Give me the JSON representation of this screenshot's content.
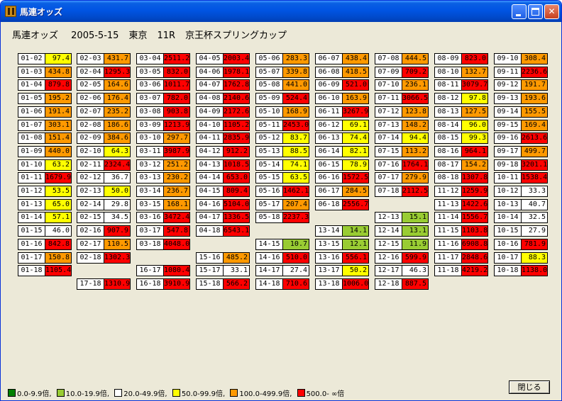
{
  "window": {
    "title": "馬連オッズ"
  },
  "titlebar_buttons": {
    "minimize": "minimize-icon",
    "maximize": "maximize-icon",
    "close": "✕"
  },
  "header": {
    "title": "馬連オッズ",
    "date": "2005-5-15",
    "venue": "東京",
    "race": "11R",
    "race_name": "京王杯スプリングカップ"
  },
  "colors": {
    "green": "#008000",
    "yellowgreen": "#99cc33",
    "white": "#ffffff",
    "yellow": "#ffff00",
    "orange": "#ff9900",
    "red": "#ff0000"
  },
  "columns": [
    [
      {
        "pair": "01-02",
        "odds": "97.4",
        "color": "yellow"
      },
      {
        "pair": "01-03",
        "odds": "434.8",
        "color": "orange"
      },
      {
        "pair": "01-04",
        "odds": "879.8",
        "color": "red"
      },
      {
        "pair": "01-05",
        "odds": "195.2",
        "color": "orange"
      },
      {
        "pair": "01-06",
        "odds": "191.4",
        "color": "orange"
      },
      {
        "pair": "01-07",
        "odds": "303.1",
        "color": "orange"
      },
      {
        "pair": "01-08",
        "odds": "151.4",
        "color": "orange"
      },
      {
        "pair": "01-09",
        "odds": "440.0",
        "color": "orange"
      },
      {
        "pair": "01-10",
        "odds": "63.2",
        "color": "yellow"
      },
      {
        "pair": "01-11",
        "odds": "1679.9",
        "color": "red"
      },
      {
        "pair": "01-12",
        "odds": "53.5",
        "color": "yellow"
      },
      {
        "pair": "01-13",
        "odds": "65.0",
        "color": "yellow"
      },
      {
        "pair": "01-14",
        "odds": "57.1",
        "color": "yellow"
      },
      {
        "pair": "01-15",
        "odds": "46.0",
        "color": "white"
      },
      {
        "pair": "01-16",
        "odds": "842.8",
        "color": "red"
      },
      {
        "pair": "01-17",
        "odds": "150.8",
        "color": "orange"
      },
      {
        "pair": "01-18",
        "odds": "1105.4",
        "color": "red"
      }
    ],
    [
      {
        "pair": "02-03",
        "odds": "431.7",
        "color": "orange"
      },
      {
        "pair": "02-04",
        "odds": "1295.3",
        "color": "red"
      },
      {
        "pair": "02-05",
        "odds": "164.6",
        "color": "orange"
      },
      {
        "pair": "02-06",
        "odds": "176.4",
        "color": "orange"
      },
      {
        "pair": "02-07",
        "odds": "235.2",
        "color": "orange"
      },
      {
        "pair": "02-08",
        "odds": "186.6",
        "color": "orange"
      },
      {
        "pair": "02-09",
        "odds": "384.6",
        "color": "orange"
      },
      {
        "pair": "02-10",
        "odds": "64.3",
        "color": "yellow"
      },
      {
        "pair": "02-11",
        "odds": "2324.4",
        "color": "red"
      },
      {
        "pair": "02-12",
        "odds": "36.7",
        "color": "white"
      },
      {
        "pair": "02-13",
        "odds": "50.0",
        "color": "yellow"
      },
      {
        "pair": "02-14",
        "odds": "29.8",
        "color": "white"
      },
      {
        "pair": "02-15",
        "odds": "34.5",
        "color": "white"
      },
      {
        "pair": "02-16",
        "odds": "907.9",
        "color": "red"
      },
      {
        "pair": "02-17",
        "odds": "110.5",
        "color": "orange"
      },
      {
        "pair": "02-18",
        "odds": "1302.3",
        "color": "red"
      },
      {
        "pair": "17-18",
        "odds": "1310.9",
        "color": "red"
      }
    ],
    [
      {
        "pair": "03-04",
        "odds": "2511.2",
        "color": "red"
      },
      {
        "pair": "03-05",
        "odds": "832.0",
        "color": "red"
      },
      {
        "pair": "03-06",
        "odds": "1011.7",
        "color": "red"
      },
      {
        "pair": "03-07",
        "odds": "782.0",
        "color": "red"
      },
      {
        "pair": "03-08",
        "odds": "903.8",
        "color": "red"
      },
      {
        "pair": "03-09",
        "odds": "1213.9",
        "color": "red"
      },
      {
        "pair": "03-10",
        "odds": "297.7",
        "color": "orange"
      },
      {
        "pair": "03-11",
        "odds": "3987.9",
        "color": "red"
      },
      {
        "pair": "03-12",
        "odds": "251.2",
        "color": "orange"
      },
      {
        "pair": "03-13",
        "odds": "230.2",
        "color": "orange"
      },
      {
        "pair": "03-14",
        "odds": "236.7",
        "color": "orange"
      },
      {
        "pair": "03-15",
        "odds": "168.1",
        "color": "orange"
      },
      {
        "pair": "03-16",
        "odds": "3472.4",
        "color": "red"
      },
      {
        "pair": "03-17",
        "odds": "547.8",
        "color": "red"
      },
      {
        "pair": "03-18",
        "odds": "4048.0",
        "color": "red"
      },
      {
        "pair": "16-17",
        "odds": "1080.4",
        "color": "red"
      },
      {
        "pair": "16-18",
        "odds": "3910.9",
        "color": "red"
      }
    ],
    [
      {
        "pair": "04-05",
        "odds": "2003.4",
        "color": "red"
      },
      {
        "pair": "04-06",
        "odds": "1978.1",
        "color": "red"
      },
      {
        "pair": "04-07",
        "odds": "1762.8",
        "color": "red"
      },
      {
        "pair": "04-08",
        "odds": "2140.6",
        "color": "red"
      },
      {
        "pair": "04-09",
        "odds": "2172.6",
        "color": "red"
      },
      {
        "pair": "04-10",
        "odds": "1105.2",
        "color": "red"
      },
      {
        "pair": "04-11",
        "odds": "2835.9",
        "color": "red"
      },
      {
        "pair": "04-12",
        "odds": "912.2",
        "color": "red"
      },
      {
        "pair": "04-13",
        "odds": "1018.5",
        "color": "red"
      },
      {
        "pair": "04-14",
        "odds": "653.0",
        "color": "red"
      },
      {
        "pair": "04-15",
        "odds": "809.4",
        "color": "red"
      },
      {
        "pair": "04-16",
        "odds": "5104.0",
        "color": "red"
      },
      {
        "pair": "04-17",
        "odds": "1336.5",
        "color": "red"
      },
      {
        "pair": "04-18",
        "odds": "6543.1",
        "color": "red"
      },
      {
        "pair": "15-16",
        "odds": "485.2",
        "color": "orange"
      },
      {
        "pair": "15-17",
        "odds": "33.1",
        "color": "white"
      },
      {
        "pair": "15-18",
        "odds": "566.2",
        "color": "red"
      }
    ],
    [
      {
        "pair": "05-06",
        "odds": "283.3",
        "color": "orange"
      },
      {
        "pair": "05-07",
        "odds": "339.8",
        "color": "orange"
      },
      {
        "pair": "05-08",
        "odds": "441.0",
        "color": "orange"
      },
      {
        "pair": "05-09",
        "odds": "524.4",
        "color": "red"
      },
      {
        "pair": "05-10",
        "odds": "168.9",
        "color": "orange"
      },
      {
        "pair": "05-11",
        "odds": "2453.0",
        "color": "red"
      },
      {
        "pair": "05-12",
        "odds": "83.7",
        "color": "yellow"
      },
      {
        "pair": "05-13",
        "odds": "88.5",
        "color": "yellow"
      },
      {
        "pair": "05-14",
        "odds": "74.1",
        "color": "yellow"
      },
      {
        "pair": "05-15",
        "odds": "63.5",
        "color": "yellow"
      },
      {
        "pair": "05-16",
        "odds": "1462.1",
        "color": "red"
      },
      {
        "pair": "05-17",
        "odds": "207.4",
        "color": "orange"
      },
      {
        "pair": "05-18",
        "odds": "2237.3",
        "color": "red"
      },
      {
        "pair": "14-15",
        "odds": "10.7",
        "color": "yellowgreen"
      },
      {
        "pair": "14-16",
        "odds": "510.0",
        "color": "red"
      },
      {
        "pair": "14-17",
        "odds": "27.4",
        "color": "white"
      },
      {
        "pair": "14-18",
        "odds": "710.6",
        "color": "red"
      }
    ],
    [
      {
        "pair": "06-07",
        "odds": "438.4",
        "color": "orange"
      },
      {
        "pair": "06-08",
        "odds": "418.5",
        "color": "orange"
      },
      {
        "pair": "06-09",
        "odds": "521.0",
        "color": "red"
      },
      {
        "pair": "06-10",
        "odds": "163.9",
        "color": "orange"
      },
      {
        "pair": "06-11",
        "odds": "3267.9",
        "color": "red"
      },
      {
        "pair": "06-12",
        "odds": "69.1",
        "color": "yellow"
      },
      {
        "pair": "06-13",
        "odds": "74.4",
        "color": "yellow"
      },
      {
        "pair": "06-14",
        "odds": "82.1",
        "color": "yellow"
      },
      {
        "pair": "06-15",
        "odds": "78.9",
        "color": "yellow"
      },
      {
        "pair": "06-16",
        "odds": "1572.5",
        "color": "red"
      },
      {
        "pair": "06-17",
        "odds": "284.5",
        "color": "orange"
      },
      {
        "pair": "06-18",
        "odds": "2556.7",
        "color": "red"
      },
      {
        "pair": "13-14",
        "odds": "14.1",
        "color": "yellowgreen"
      },
      {
        "pair": "13-15",
        "odds": "12.1",
        "color": "yellowgreen"
      },
      {
        "pair": "13-16",
        "odds": "556.1",
        "color": "red"
      },
      {
        "pair": "13-17",
        "odds": "50.2",
        "color": "yellow"
      },
      {
        "pair": "13-18",
        "odds": "1006.0",
        "color": "red"
      }
    ],
    [
      {
        "pair": "07-08",
        "odds": "444.5",
        "color": "orange"
      },
      {
        "pair": "07-09",
        "odds": "709.2",
        "color": "red"
      },
      {
        "pair": "07-10",
        "odds": "236.1",
        "color": "orange"
      },
      {
        "pair": "07-11",
        "odds": "3066.5",
        "color": "red"
      },
      {
        "pair": "07-12",
        "odds": "123.8",
        "color": "orange"
      },
      {
        "pair": "07-13",
        "odds": "148.2",
        "color": "orange"
      },
      {
        "pair": "07-14",
        "odds": "94.4",
        "color": "yellow"
      },
      {
        "pair": "07-15",
        "odds": "113.2",
        "color": "orange"
      },
      {
        "pair": "07-16",
        "odds": "1764.1",
        "color": "red"
      },
      {
        "pair": "07-17",
        "odds": "279.9",
        "color": "orange"
      },
      {
        "pair": "07-18",
        "odds": "2112.5",
        "color": "red"
      },
      {
        "pair": "12-13",
        "odds": "15.1",
        "color": "yellowgreen"
      },
      {
        "pair": "12-14",
        "odds": "13.1",
        "color": "yellowgreen"
      },
      {
        "pair": "12-15",
        "odds": "11.9",
        "color": "yellowgreen"
      },
      {
        "pair": "12-16",
        "odds": "599.9",
        "color": "red"
      },
      {
        "pair": "12-17",
        "odds": "46.3",
        "color": "white"
      },
      {
        "pair": "12-18",
        "odds": "887.5",
        "color": "red"
      }
    ],
    [
      {
        "pair": "08-09",
        "odds": "823.0",
        "color": "red"
      },
      {
        "pair": "08-10",
        "odds": "132.7",
        "color": "orange"
      },
      {
        "pair": "08-11",
        "odds": "3079.7",
        "color": "red"
      },
      {
        "pair": "08-12",
        "odds": "97.8",
        "color": "yellow"
      },
      {
        "pair": "08-13",
        "odds": "127.5",
        "color": "orange"
      },
      {
        "pair": "08-14",
        "odds": "96.0",
        "color": "yellow"
      },
      {
        "pair": "08-15",
        "odds": "99.3",
        "color": "yellow"
      },
      {
        "pair": "08-16",
        "odds": "964.1",
        "color": "red"
      },
      {
        "pair": "08-17",
        "odds": "154.2",
        "color": "orange"
      },
      {
        "pair": "08-18",
        "odds": "1307.8",
        "color": "red"
      },
      {
        "pair": "11-12",
        "odds": "1259.9",
        "color": "red"
      },
      {
        "pair": "11-13",
        "odds": "1422.6",
        "color": "red"
      },
      {
        "pair": "11-14",
        "odds": "1556.7",
        "color": "red"
      },
      {
        "pair": "11-15",
        "odds": "1103.8",
        "color": "red"
      },
      {
        "pair": "11-16",
        "odds": "6908.8",
        "color": "red"
      },
      {
        "pair": "11-17",
        "odds": "2848.6",
        "color": "red"
      },
      {
        "pair": "11-18",
        "odds": "4219.2",
        "color": "red"
      }
    ],
    [
      {
        "pair": "09-10",
        "odds": "308.4",
        "color": "orange"
      },
      {
        "pair": "09-11",
        "odds": "2236.6",
        "color": "red"
      },
      {
        "pair": "09-12",
        "odds": "191.7",
        "color": "orange"
      },
      {
        "pair": "09-13",
        "odds": "193.6",
        "color": "orange"
      },
      {
        "pair": "09-14",
        "odds": "155.5",
        "color": "orange"
      },
      {
        "pair": "09-15",
        "odds": "169.4",
        "color": "orange"
      },
      {
        "pair": "09-16",
        "odds": "2613.6",
        "color": "red"
      },
      {
        "pair": "09-17",
        "odds": "499.7",
        "color": "orange"
      },
      {
        "pair": "09-18",
        "odds": "3201.1",
        "color": "red"
      },
      {
        "pair": "10-11",
        "odds": "1538.4",
        "color": "red"
      },
      {
        "pair": "10-12",
        "odds": "33.3",
        "color": "white"
      },
      {
        "pair": "10-13",
        "odds": "40.7",
        "color": "white"
      },
      {
        "pair": "10-14",
        "odds": "32.5",
        "color": "white"
      },
      {
        "pair": "10-15",
        "odds": "27.9",
        "color": "white"
      },
      {
        "pair": "10-16",
        "odds": "781.9",
        "color": "red"
      },
      {
        "pair": "10-17",
        "odds": "88.3",
        "color": "yellow"
      },
      {
        "pair": "10-18",
        "odds": "1138.0",
        "color": "red"
      }
    ]
  ],
  "legend": [
    {
      "label": "0.0-9.9倍,",
      "color": "green"
    },
    {
      "label": "10.0-19.9倍,",
      "color": "yellowgreen"
    },
    {
      "label": "20.0-49.9倍,",
      "color": "white"
    },
    {
      "label": "50.0-99.9倍,",
      "color": "yellow"
    },
    {
      "label": "100.0-499.9倍,",
      "color": "orange"
    },
    {
      "label": "500.0- ∞倍",
      "color": "red"
    }
  ],
  "close_button": {
    "label": "閉じる"
  }
}
